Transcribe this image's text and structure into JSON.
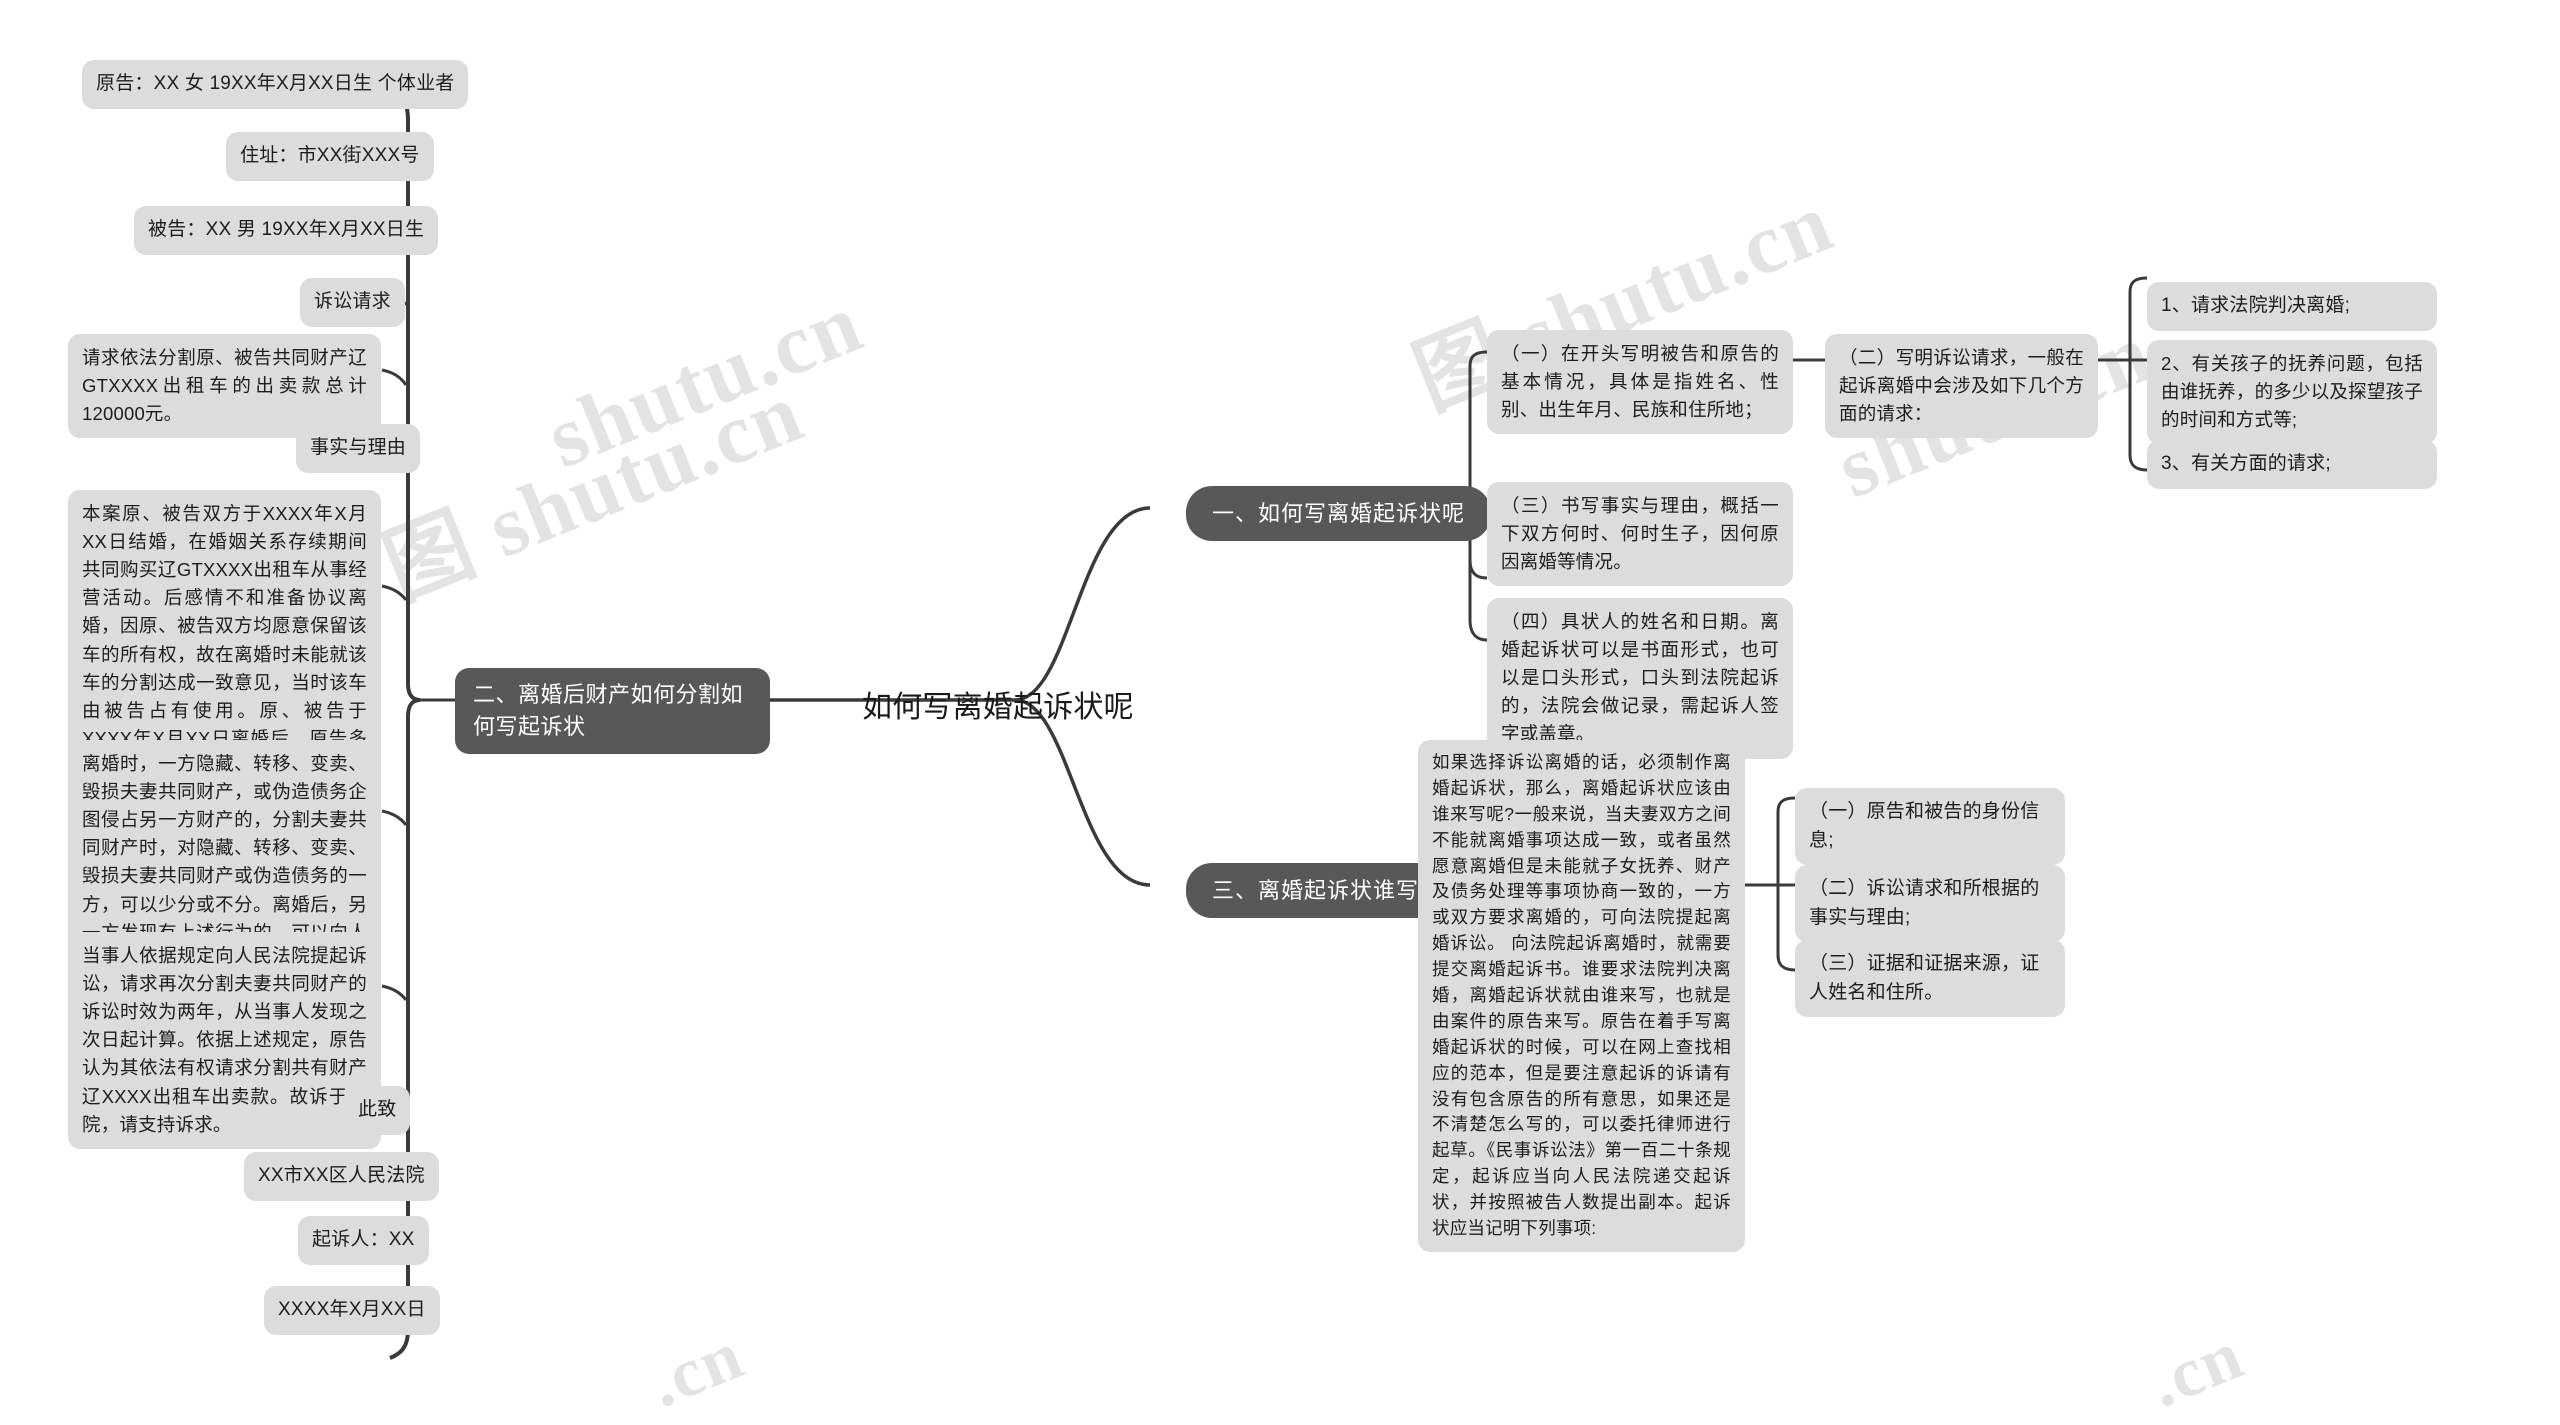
{
  "center": {
    "title": "如何写离婚起诉状呢"
  },
  "watermarks": [
    "图 shutu.cn",
    "shutu.cn",
    "shutu.cn",
    "图 shutu.cn",
    ".cn",
    ".cn"
  ],
  "branches": [
    {
      "id": "branch-1",
      "label": "一、如何写离婚起诉状呢",
      "children": [
        {
          "id": "b1-c1",
          "label": "（一）在开头写明被告和原告的基本情况，具体是指姓名、性别、出生年月、民族和住所地；"
        },
        {
          "id": "b1-c2",
          "label": "（二）写明诉讼请求，一般在起诉离婚中会涉及如下几个方面的请求：",
          "children": [
            {
              "id": "b1-c2-1",
              "label": "1、请求法院判决离婚;"
            },
            {
              "id": "b1-c2-2",
              "label": "2、有关孩子的抚养问题，包括由谁抚养，的多少以及探望孩子的时间和方式等;"
            },
            {
              "id": "b1-c2-3",
              "label": "3、有关方面的请求;"
            }
          ]
        },
        {
          "id": "b1-c3",
          "label": "（三）书写事实与理由，概括一下双方何时、何时生子，因何原因离婚等情况。"
        },
        {
          "id": "b1-c4",
          "label": "（四）具状人的姓名和日期。离婚起诉状可以是书面形式，也可以是口头形式，口头到法院起诉的，法院会做记录，需起诉人签字或盖章。"
        }
      ]
    },
    {
      "id": "branch-2",
      "label": "二、离婚后财产如何分割如何写起诉状",
      "children": [
        {
          "id": "b2-c1",
          "label": "原告：XX 女 19XX年X月XX日生 个体业者"
        },
        {
          "id": "b2-c2",
          "label": "住址：市XX街XXX号"
        },
        {
          "id": "b2-c3",
          "label": "被告：XX 男 19XX年X月XX日生"
        },
        {
          "id": "b2-c4",
          "label": "诉讼请求"
        },
        {
          "id": "b2-c5",
          "label": "请求依法分割原、被告共同财产辽GTXXXX出租车的出卖款总计120000元。"
        },
        {
          "id": "b2-c6",
          "label": "事实与理由"
        },
        {
          "id": "b2-c7",
          "label": "本案原、被告双方于XXXX年X月XX日结婚，在婚姻关系存续期间共同购买辽GTXXXX出租车从事经营活动。后感情不和准备协议离婚，因原、被告双方均愿意保留该车的所有权，故在离婚时未能就该车的分割达成一致意见，当时该车由被告占有使用。原、被告于XXXX年X月XX日离婚后，原告多次找被告协商解决此事，但被告不予理睬并拒绝提供该车的下落。原告对此产生怀疑经多方了解，才得知被告在离婚的前一天就私下变卖了该车。"
        },
        {
          "id": "b2-c8",
          "label": "离婚时，一方隐藏、转移、变卖、毁损夫妻共同财产，或伪造债务企图侵占另一方财产的，分割夫妻共同财产时，对隐藏、转移、变卖、毁损夫妻共同财产或伪造债务的一方，可以少分或不分。离婚后，另一方发现有上述行为的，可以向人民法院提起诉讼，请求再次分割夫妻共同财产。"
        },
        {
          "id": "b2-c9",
          "label": "当事人依据规定向人民法院提起诉讼，请求再次分割夫妻共同财产的诉讼时效为两年，从当事人发现之次日起计算。依据上述规定，原告认为其依法有权请求分割共有财产辽XXXX出租车出卖款。故诉于贵院，请支持诉求。"
        },
        {
          "id": "b2-c10",
          "label": "此致"
        },
        {
          "id": "b2-c11",
          "label": "XX市XX区人民法院"
        },
        {
          "id": "b2-c12",
          "label": "起诉人：XX"
        },
        {
          "id": "b2-c13",
          "label": "XXXX年X月XX日"
        }
      ]
    },
    {
      "id": "branch-3",
      "label": "三、离婚起诉状谁写",
      "children": [
        {
          "id": "b3-c1",
          "label": "如果选择诉讼离婚的话，必须制作离婚起诉状，那么，离婚起诉状应该由谁来写呢?一般来说，当夫妻双方之间不能就离婚事项达成一致，或者虽然愿意离婚但是未能就子女抚养、财产及债务处理等事项协商一致的，一方或双方要求离婚的，可向法院提起离婚诉讼。 向法院起诉离婚时，就需要提交离婚起诉书。谁要求法院判决离婚，离婚起诉状就由谁来写，也就是由案件的原告来写。原告在着手写离婚起诉状的时候，可以在网上查找相应的范本，但是要注意起诉的诉请有没有包含原告的所有意思，如果还是不清楚怎么写的，可以委托律师进行起草。《民事诉讼法》第一百二十条规定，起诉应当向人民法院递交起诉状，并按照被告人数提出副本。起诉状应当记明下列事项:",
          "children": [
            {
              "id": "b3-c1-1",
              "label": "（一）原告和被告的身份信息;"
            },
            {
              "id": "b3-c1-2",
              "label": "（二）诉讼请求和所根据的事实与理由;"
            },
            {
              "id": "b3-c1-3",
              "label": "（三）证据和证据来源，证人姓名和住所。"
            }
          ]
        }
      ]
    }
  ],
  "colors": {
    "node_bg": "#dcdcdc",
    "node_text": "#1d1d1d",
    "branch_bg": "#585858",
    "branch_text": "#ffffff",
    "link": "#3a3a3a",
    "canvas_bg": "#ffffff",
    "watermark": "#e3e3e3"
  }
}
